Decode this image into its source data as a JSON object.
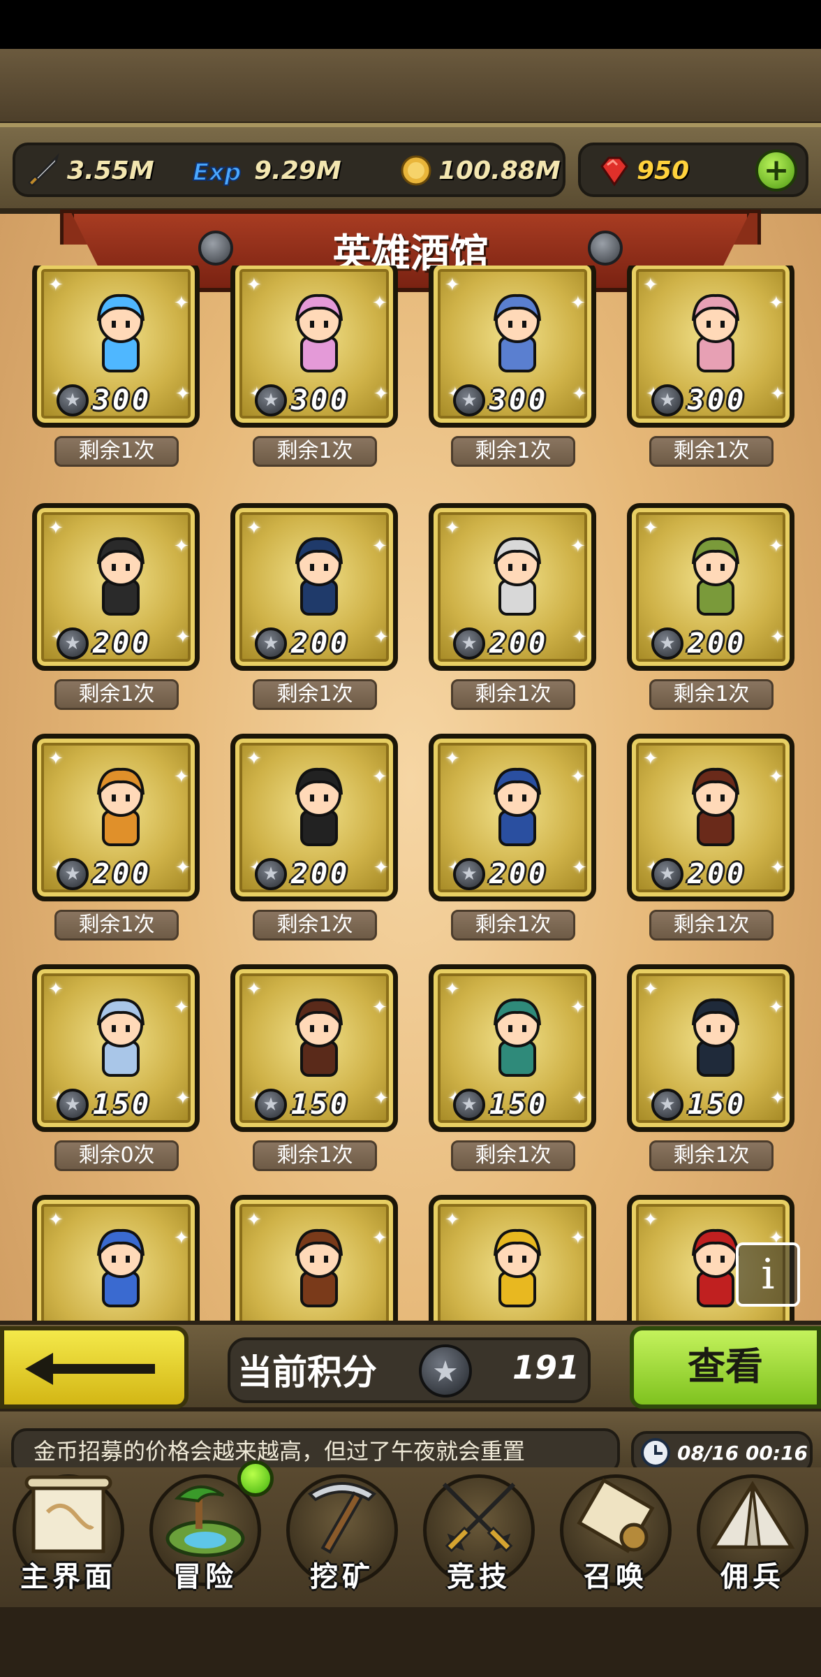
{
  "currencies": {
    "attack": {
      "icon": "sword-icon",
      "value": "3.55M"
    },
    "exp": {
      "icon": "exp-icon",
      "value": "9.29M"
    },
    "gold": {
      "icon": "gold-coin-icon",
      "value": "100.88M"
    },
    "ruby": {
      "icon": "ruby-gem-icon",
      "value": "950"
    }
  },
  "title": "英雄酒馆",
  "heroes": [
    {
      "price": "300",
      "remaining": "剩余1次",
      "color": "#4fb7ff"
    },
    {
      "price": "300",
      "remaining": "剩余1次",
      "color": "#e49ad8"
    },
    {
      "price": "300",
      "remaining": "剩余1次",
      "color": "#5a7fd0"
    },
    {
      "price": "300",
      "remaining": "剩余1次",
      "color": "#e7a0b4"
    },
    {
      "price": "200",
      "remaining": "剩余1次",
      "color": "#2a2a2a"
    },
    {
      "price": "200",
      "remaining": "剩余1次",
      "color": "#1f3a6a"
    },
    {
      "price": "200",
      "remaining": "剩余1次",
      "color": "#d8d8d8"
    },
    {
      "price": "200",
      "remaining": "剩余1次",
      "color": "#7a9a3a"
    },
    {
      "price": "200",
      "remaining": "剩余1次",
      "color": "#e0902a"
    },
    {
      "price": "200",
      "remaining": "剩余1次",
      "color": "#222222"
    },
    {
      "price": "200",
      "remaining": "剩余1次",
      "color": "#2a4fa0"
    },
    {
      "price": "200",
      "remaining": "剩余1次",
      "color": "#6a2a1a"
    },
    {
      "price": "150",
      "remaining": "剩余0次",
      "color": "#a9c6e8"
    },
    {
      "price": "150",
      "remaining": "剩余1次",
      "color": "#5a2a1a"
    },
    {
      "price": "150",
      "remaining": "剩余1次",
      "color": "#2f8a7a"
    },
    {
      "price": "150",
      "remaining": "剩余1次",
      "color": "#1f2a3a"
    },
    {
      "price": "",
      "remaining": "",
      "color": "#3a6ad0"
    },
    {
      "price": "",
      "remaining": "",
      "color": "#7a3a1a"
    },
    {
      "price": "",
      "remaining": "",
      "color": "#e8b820"
    },
    {
      "price": "",
      "remaining": "",
      "color": "#c02020"
    }
  ],
  "score": {
    "label": "当前积分",
    "value": "191"
  },
  "view_button": "查看",
  "ticker": "金币招募的价格会越来越高，但过了午夜就会重置",
  "clock": "08/16 00:16",
  "nav": [
    {
      "label": "主界面",
      "icon": "scroll-map-icon"
    },
    {
      "label": "冒险",
      "icon": "island-icon"
    },
    {
      "label": "挖矿",
      "icon": "pickaxe-icon"
    },
    {
      "label": "竞技",
      "icon": "crossed-swords-icon"
    },
    {
      "label": "召唤",
      "icon": "summon-scroll-icon"
    },
    {
      "label": "佣兵",
      "icon": "tent-icon"
    }
  ]
}
